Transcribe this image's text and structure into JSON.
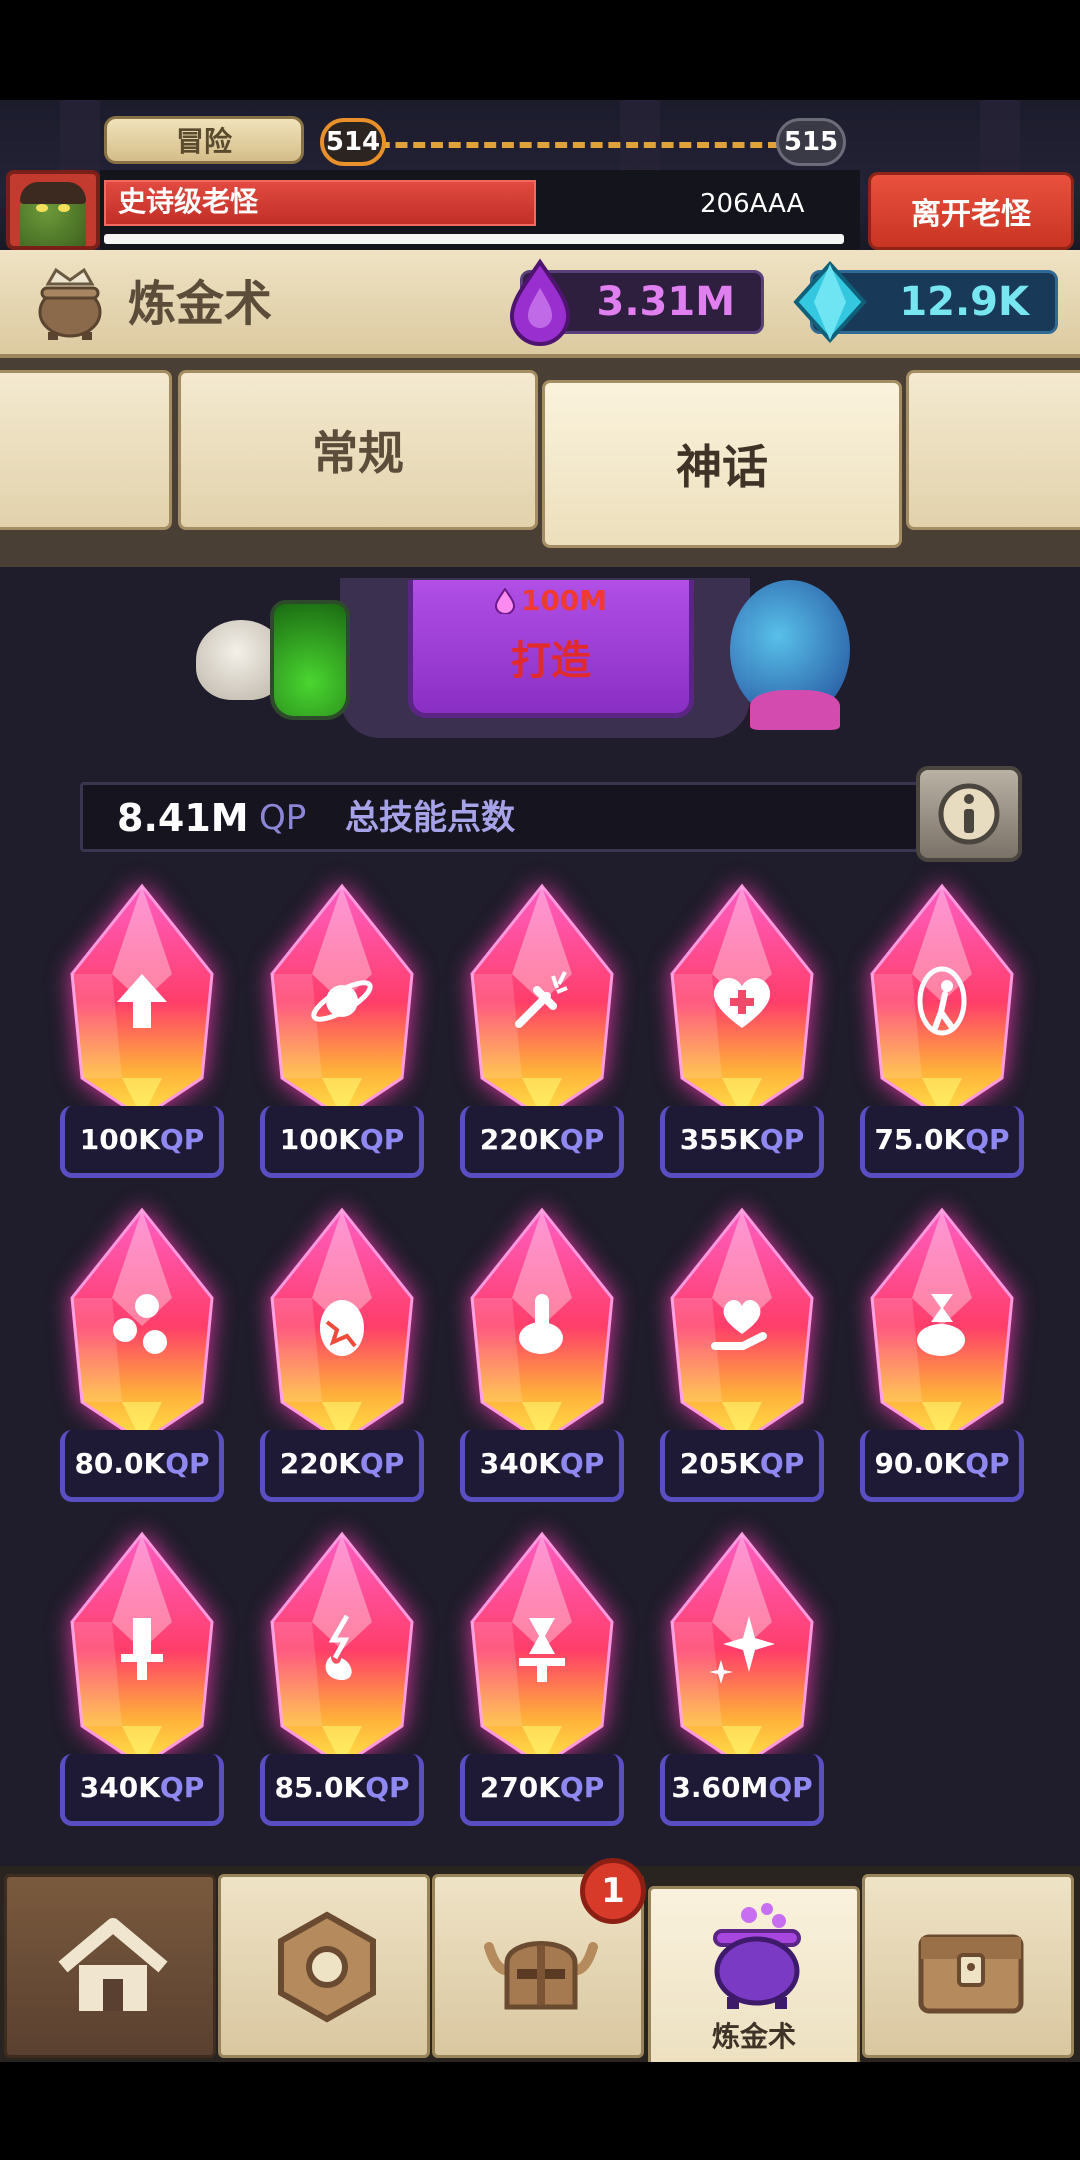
{
  "header": {
    "adventure_label": "冒险",
    "current_level": "514",
    "next_level": "515",
    "boss_name": "史诗级老怪",
    "boss_hp": "206AAA",
    "boss_hp_fraction": 0.57,
    "leave_label": "离开老怪"
  },
  "panel": {
    "title": "炼金术",
    "essence": "3.31M",
    "gems": "12.9K"
  },
  "tabs": {
    "regular": "常规",
    "mythic": "神话"
  },
  "forge": {
    "cost": "100M",
    "label": "打造"
  },
  "qp": {
    "value": "8.41M",
    "unit": "QP",
    "label": "总技能点数"
  },
  "crystals": [
    {
      "cost": "100K",
      "unit": "QP",
      "icon": "arrow-up-icon"
    },
    {
      "cost": "100K",
      "unit": "QP",
      "icon": "planet-icon"
    },
    {
      "cost": "220K",
      "unit": "QP",
      "icon": "sword-impact-icon"
    },
    {
      "cost": "355K",
      "unit": "QP",
      "icon": "heart-health-icon"
    },
    {
      "cost": "75.0K",
      "unit": "QP",
      "icon": "portal-person-icon"
    },
    {
      "cost": "80.0K",
      "unit": "QP",
      "icon": "coins-icon"
    },
    {
      "cost": "220K",
      "unit": "QP",
      "icon": "cracked-egg-icon"
    },
    {
      "cost": "340K",
      "unit": "QP",
      "icon": "hand-point-icon"
    },
    {
      "cost": "205K",
      "unit": "QP",
      "icon": "hand-heart-coin-icon"
    },
    {
      "cost": "90.0K",
      "unit": "QP",
      "icon": "hand-hourglass-icon"
    },
    {
      "cost": "340K",
      "unit": "QP",
      "icon": "broken-sword-icon"
    },
    {
      "cost": "85.0K",
      "unit": "QP",
      "icon": "lightning-fire-icon"
    },
    {
      "cost": "270K",
      "unit": "QP",
      "icon": "sword-hourglass-icon"
    },
    {
      "cost": "3.60M",
      "unit": "QP",
      "icon": "sparkle-icon"
    }
  ],
  "nav": {
    "alchemy_label": "炼金术",
    "hero_badge": "1"
  }
}
